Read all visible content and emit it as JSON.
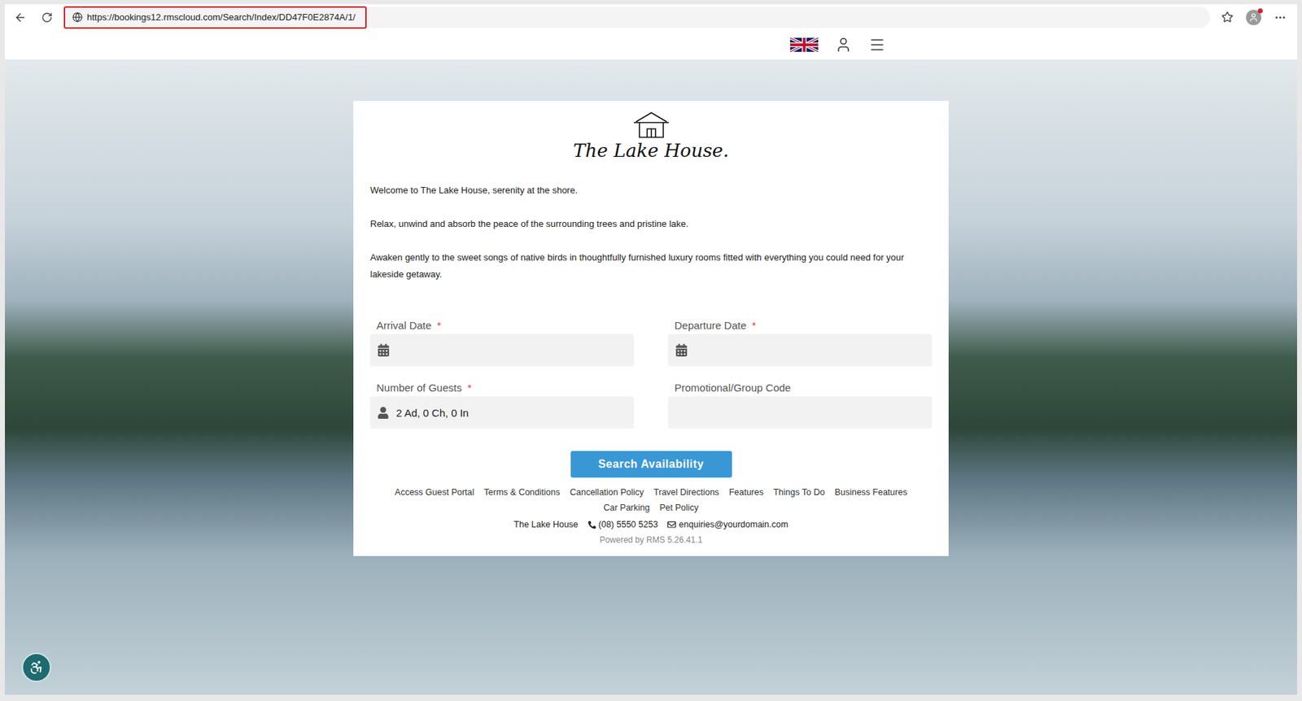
{
  "browser": {
    "url": "https://bookings12.rmscloud.com/Search/Index/DD47F0E2874A/1/",
    "url_highlighted": true
  },
  "logo": {
    "text": "The Lake House."
  },
  "intro": [
    "Welcome to The Lake House, serenity at the shore.",
    "Relax, unwind and absorb the peace of the surrounding trees and pristine lake.",
    "Awaken gently to the sweet songs of native birds in thoughtfully furnished luxury rooms fitted with everything you could need for your lakeside getaway."
  ],
  "required_mark": "*",
  "fields": [
    {
      "label": "Arrival Date",
      "required": true,
      "value": "",
      "kind": "date"
    },
    {
      "label": "Departure Date",
      "required": true,
      "value": "",
      "kind": "date"
    },
    {
      "label": "Number of Guests",
      "required": true,
      "value": "2 Ad, 0 Ch, 0 In",
      "kind": "guests"
    },
    {
      "label": "Promotional/Group Code",
      "required": false,
      "value": "",
      "kind": "text"
    }
  ],
  "search_button": "Search Availability",
  "footer_links": [
    "Access Guest Portal",
    "Terms & Conditions",
    "Cancellation Policy",
    "Travel Directions",
    "Features",
    "Things To Do",
    "Business Features",
    "Car Parking",
    "Pet Policy"
  ],
  "contact": {
    "name": "The Lake House",
    "phone": "(08) 5550 5253",
    "email": "enquiries@yourdomain.com"
  },
  "powered_by": "Powered by RMS 5.26.41.1"
}
